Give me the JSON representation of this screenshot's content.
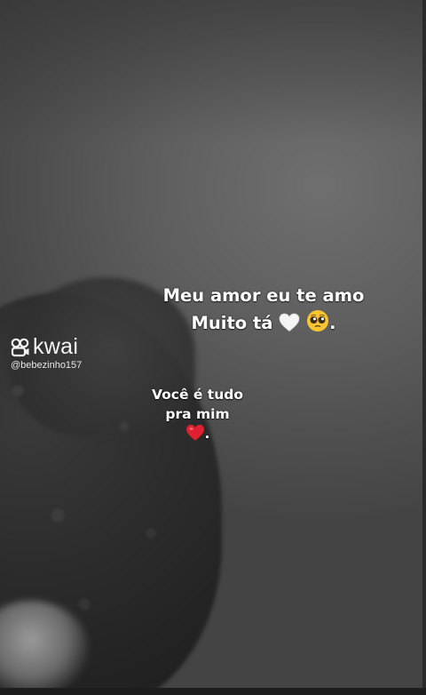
{
  "watermark": {
    "brand": "kwai",
    "handle": "@bebezinho157",
    "icon": "kwai-logo-icon"
  },
  "caption_main": {
    "line1": "Meu amor eu te amo",
    "line2": "Muito tá",
    "line2_suffix": ".",
    "emoji": [
      "white-heart-icon",
      "pleading-face-icon"
    ]
  },
  "caption_small": {
    "line1": "Você é tudo",
    "line2": "pra mim",
    "line3_suffix": ".",
    "emoji": [
      "red-heart-icon"
    ]
  },
  "colors": {
    "text": "#ffffff",
    "heart_red": "#e0202f",
    "heart_white": "#f5f5f5",
    "face_yellow": "#f7c531"
  }
}
